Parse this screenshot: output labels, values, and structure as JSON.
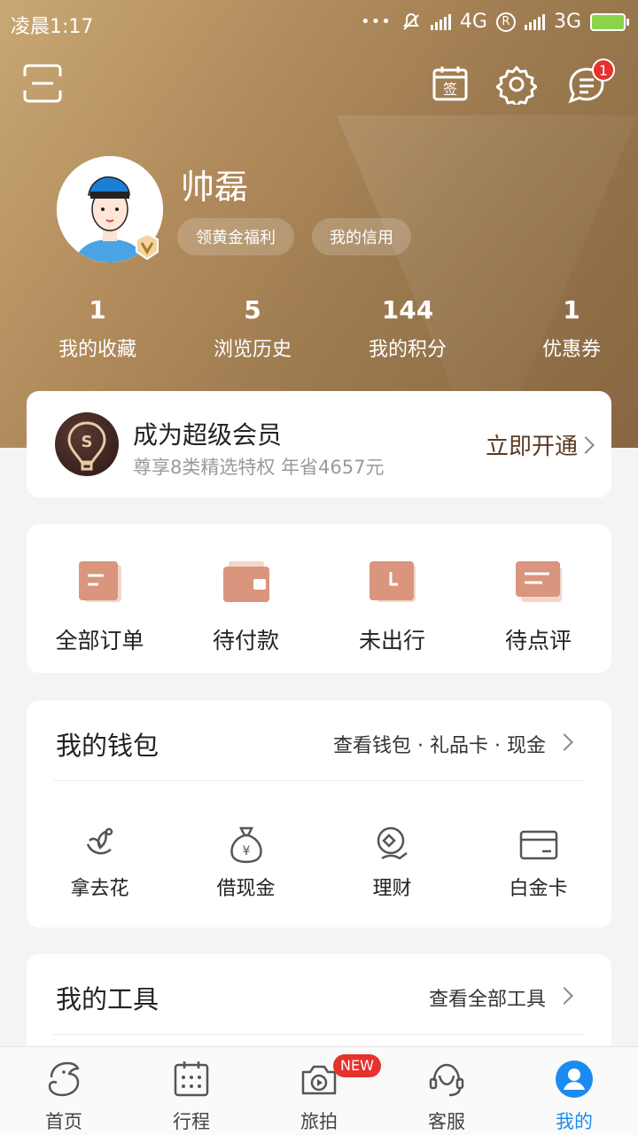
{
  "status_bar": {
    "time": "凌晨1:17",
    "dots": "•••",
    "network1": "4G",
    "roaming": "R",
    "network2": "3G"
  },
  "header": {
    "scan_icon": "scan-icon",
    "checkin_icon": "checkin-calendar-icon",
    "checkin_glyph": "签",
    "settings_icon": "gear-icon",
    "message_icon": "message-icon",
    "message_badge": "1"
  },
  "profile": {
    "name": "帅磊",
    "pills": [
      "领黄金福利",
      "我的信用"
    ]
  },
  "stats": [
    {
      "num": "1",
      "label": "我的收藏"
    },
    {
      "num": "5",
      "label": "浏览历史"
    },
    {
      "num": "144",
      "label": "我的积分"
    },
    {
      "num": "1",
      "label": "优惠券"
    }
  ],
  "member": {
    "title": "成为超级会员",
    "subtitle": "尊享8类精选特权 年省4657元",
    "cta": "立即开通"
  },
  "orders": [
    {
      "label": "全部订单",
      "icon": "all-orders-icon"
    },
    {
      "label": "待付款",
      "icon": "wallet-pay-icon"
    },
    {
      "label": "未出行",
      "icon": "clock-icon"
    },
    {
      "label": "待点评",
      "icon": "review-icon"
    }
  ],
  "wallet": {
    "title": "我的钱包",
    "link": "查看钱包 · 礼品卡 · 现金",
    "items": [
      {
        "label": "拿去花",
        "icon": "flower-icon"
      },
      {
        "label": "借现金",
        "icon": "money-bag-icon"
      },
      {
        "label": "理财",
        "icon": "finance-icon"
      },
      {
        "label": "白金卡",
        "icon": "card-icon"
      }
    ]
  },
  "tools": {
    "title": "我的工具",
    "link": "查看全部工具"
  },
  "tabbar": {
    "items": [
      {
        "label": "首页",
        "icon": "home-dolphin-icon"
      },
      {
        "label": "行程",
        "icon": "calendar-icon"
      },
      {
        "label": "旅拍",
        "icon": "camera-icon"
      },
      {
        "label": "客服",
        "icon": "service-icon"
      },
      {
        "label": "我的",
        "icon": "profile-icon"
      }
    ],
    "new_badge": "NEW",
    "active_color": "#1a8cf0"
  }
}
